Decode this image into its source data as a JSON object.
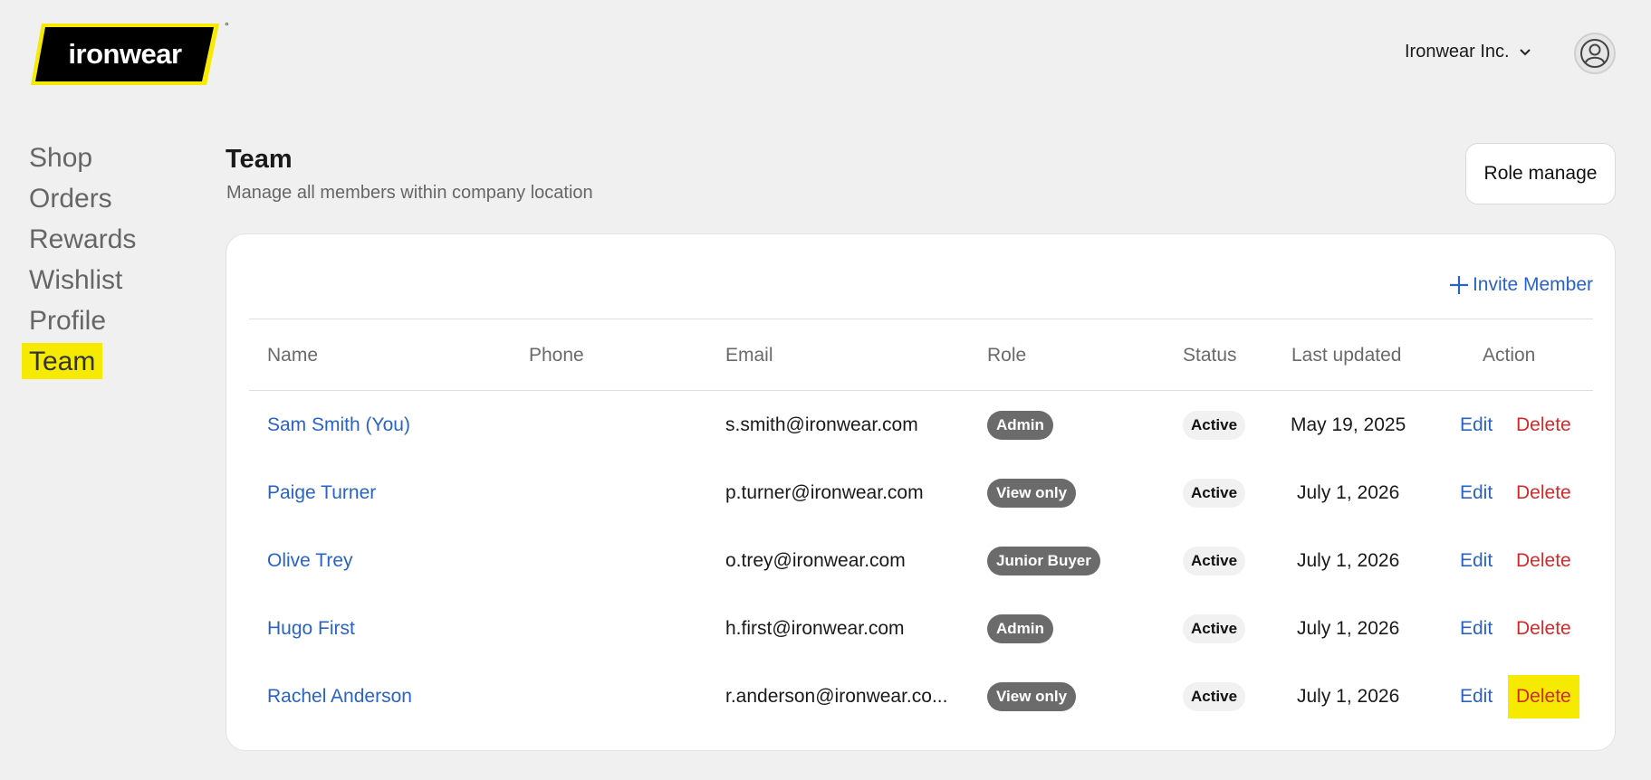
{
  "header": {
    "logo_text": "ironwear",
    "logo_mark": "°",
    "company_name": "Ironwear Inc.",
    "company_icon": "chevron-down-icon",
    "avatar_icon": "user-icon"
  },
  "sidebar": {
    "items": [
      {
        "label": "Shop"
      },
      {
        "label": "Orders"
      },
      {
        "label": "Rewards"
      },
      {
        "label": "Wishlist"
      },
      {
        "label": "Profile"
      },
      {
        "label": "Team",
        "active": true
      }
    ]
  },
  "page": {
    "title": "Team",
    "subtitle": "Manage all members within company location",
    "role_manage_label": "Role manage"
  },
  "table": {
    "invite_label": "Invite Member",
    "columns": [
      "Name",
      "Phone",
      "Email",
      "Role",
      "Status",
      "Last updated",
      "Action"
    ],
    "edit_label": "Edit",
    "delete_label": "Delete",
    "rows": [
      {
        "name": "Sam Smith (You)",
        "phone": "",
        "email": "s.smith@ironwear.com",
        "role": "Admin",
        "status": "Active",
        "updated": "May 19, 2025"
      },
      {
        "name": "Paige Turner",
        "phone": "",
        "email": "p.turner@ironwear.com",
        "role": "View only",
        "status": "Active",
        "updated": "July 1, 2026"
      },
      {
        "name": "Olive Trey",
        "phone": "",
        "email": "o.trey@ironwear.com",
        "role": "Junior Buyer",
        "status": "Active",
        "updated": "July 1, 2026"
      },
      {
        "name": "Hugo First",
        "phone": "",
        "email": "h.first@ironwear.com",
        "role": "Admin",
        "status": "Active",
        "updated": "July 1, 2026"
      },
      {
        "name": "Rachel Anderson",
        "phone": "",
        "email": "r.anderson@ironwear.co...",
        "role": "View only",
        "status": "Active",
        "updated": "July 1, 2026"
      }
    ]
  },
  "colors": {
    "accent_yellow": "#f5ea00",
    "link_blue": "#2a63c4",
    "delete_red": "#d12a2a",
    "badge_gray": "#6b6b6b",
    "background": "#f0f0f0"
  }
}
